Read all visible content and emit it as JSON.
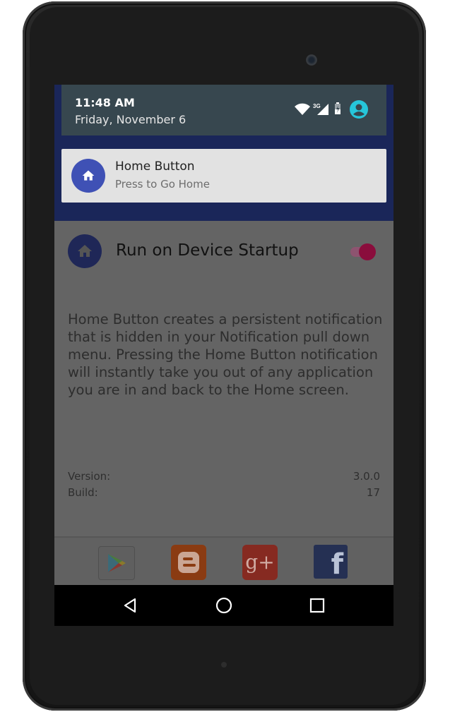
{
  "status": {
    "time": "11:48 AM",
    "date": "Friday, November 6",
    "network": "3G"
  },
  "notification": {
    "title": "Home Button",
    "text": "Press to Go Home"
  },
  "app": {
    "setting_label": "Run on Device Startup",
    "startup_enabled": true,
    "description": "Home Button creates a persistent notification that is hidden in your Notification pull down menu. Pressing the Home Button notification will instantly take you out of any application you are in and back to the Home screen.",
    "version_label": "Version:",
    "version_value": "3.0.0",
    "build_label": "Build:",
    "build_value": "17"
  },
  "social_icons": [
    "play-store-icon",
    "blogger-icon",
    "google-plus-icon",
    "facebook-icon"
  ],
  "social_text": {
    "gplus": "g+",
    "fb": "f"
  },
  "colors": {
    "shade_bg": "#1a2659",
    "notif_accent": "#3f51b5",
    "toggle_on": "#8a0d3c"
  }
}
